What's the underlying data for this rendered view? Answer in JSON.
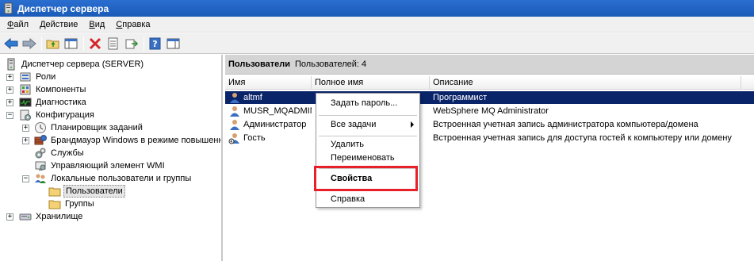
{
  "window": {
    "title": "Диспетчер сервера"
  },
  "menu": [
    "Файл",
    "Действие",
    "Вид",
    "Справка"
  ],
  "toolbar": {
    "buttons": [
      "back-icon",
      "forward-icon",
      "up-folder-icon",
      "show-hide-tree-icon",
      "delete-icon",
      "properties-icon",
      "export-icon",
      "help-icon",
      "action-pane-icon"
    ]
  },
  "tree": {
    "root": "Диспетчер сервера (SERVER)",
    "roles": "Роли",
    "features": "Компоненты",
    "diagnostics": "Диагностика",
    "configuration": "Конфигурация",
    "task_scheduler": "Планировщик заданий",
    "firewall": "Брандмауэр Windows в режиме повышенн",
    "services": "Службы",
    "wmi": "Управляющий элемент WMI",
    "local_users": "Локальные пользователи и группы",
    "users": "Пользователи",
    "groups": "Группы",
    "storage": "Хранилище"
  },
  "pane_header": {
    "title": "Пользователи",
    "count": "Пользователей: 4"
  },
  "columns": {
    "name": "Имя",
    "full_name": "Полное имя",
    "description": "Описание"
  },
  "users": [
    {
      "name": "altmf",
      "full_name": "",
      "description": "Программист"
    },
    {
      "name": "MUSR_MQADMIN",
      "full_name": "",
      "description": "WebSphere MQ Administrator"
    },
    {
      "name": "Администратор",
      "full_name": "",
      "description": "Встроенная учетная запись администратора компьютера/домена"
    },
    {
      "name": "Гость",
      "full_name": "",
      "description": "Встроенная учетная запись для доступа гостей к компьютеру или домену"
    }
  ],
  "context_menu": {
    "set_password": "Задать пароль...",
    "all_tasks": "Все задачи",
    "delete": "Удалить",
    "rename": "Переименовать",
    "properties": "Свойства",
    "help": "Справка"
  },
  "colors": {
    "title_bar": "#1a5bb8",
    "selection": "#0a246a",
    "highlight": "#e8202a"
  }
}
